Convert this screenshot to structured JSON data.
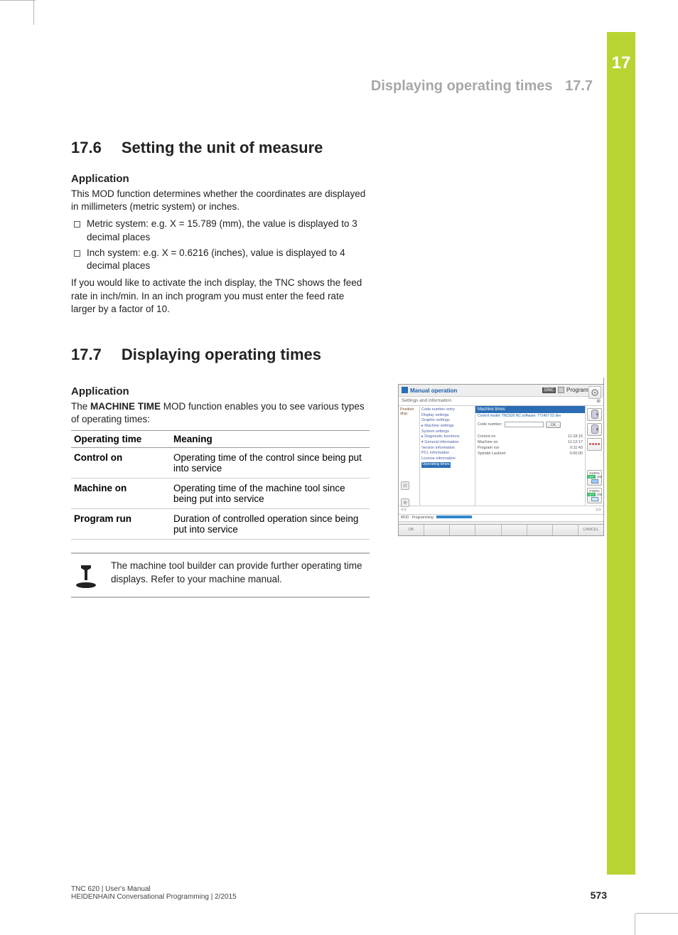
{
  "chapter_tab": "17",
  "running_head": {
    "title": "Displaying operating times",
    "section": "17.7"
  },
  "section_176": {
    "num": "17.6",
    "title": "Setting the unit of measure",
    "h3": "Application",
    "p1": "This MOD function determines whether the coordinates are displayed in millimeters (metric system) or inches.",
    "li1": "Metric system: e.g. X = 15.789 (mm), the value is displayed to 3 decimal places",
    "li2": "Inch system: e.g. X = 0.6216 (inches), value is displayed to 4 decimal places",
    "p2": "If you would like to activate the inch display, the TNC shows the feed rate in inch/min. In an inch program you must enter the feed rate larger by a factor of 10."
  },
  "section_177": {
    "num": "17.7",
    "title": "Displaying operating times",
    "h3": "Application",
    "intro_pre": "The ",
    "intro_bold": "MACHINE TIME",
    "intro_post": " MOD function enables you to see various types of operating times:",
    "th1": "Operating time",
    "th2": "Meaning",
    "rows": [
      {
        "k": "Control on",
        "v": "Operating time of the control since being put into service"
      },
      {
        "k": "Machine on",
        "v": "Operating time of the machine tool since being put into service"
      },
      {
        "k": "Program run",
        "v": "Duration of controlled operation since being put into service"
      }
    ],
    "note": "The machine tool builder can provide further operating time displays. Refer to your machine manual."
  },
  "figure": {
    "title_left": "Manual operation",
    "dnc": "DNC",
    "title_right": "Programming",
    "status_left": "Settings and information",
    "pos_tab": "Position disp.",
    "tree": [
      "Code number entry",
      "Display settings",
      "Graphic settings",
      "▸ Machine settings",
      "System settings",
      "▸ Diagnostic functions",
      "▾ General information",
      "   Version information",
      "   PCL information",
      "   License information"
    ],
    "tree_sel": "Operating times",
    "panel_title": "Machine times",
    "panel_sub": "Control model: TNC620 NC software: 771407 02 dev",
    "code_label": "Code number:",
    "ok": "OK",
    "kv": [
      {
        "k": "Control on",
        "v": "11:18:15"
      },
      {
        "k": "Machine on",
        "v": "11:12:17"
      },
      {
        "k": "Program run",
        "v": "0:11:43"
      },
      {
        "k": "Spindel Laufzeit",
        "v": "0:00:00"
      }
    ],
    "s100": "S100%",
    "off": "OFF",
    "on": "ON",
    "f100": "F100%",
    "soft_ok": "OK",
    "soft_cancel": "CANCEL",
    "scroll_arr_l": "<<",
    "scroll_arr_r": ">>"
  },
  "footer": {
    "l1": "TNC 620 | User's Manual",
    "l2": "HEIDENHAIN Conversational Programming | 2/2015",
    "page": "573"
  }
}
